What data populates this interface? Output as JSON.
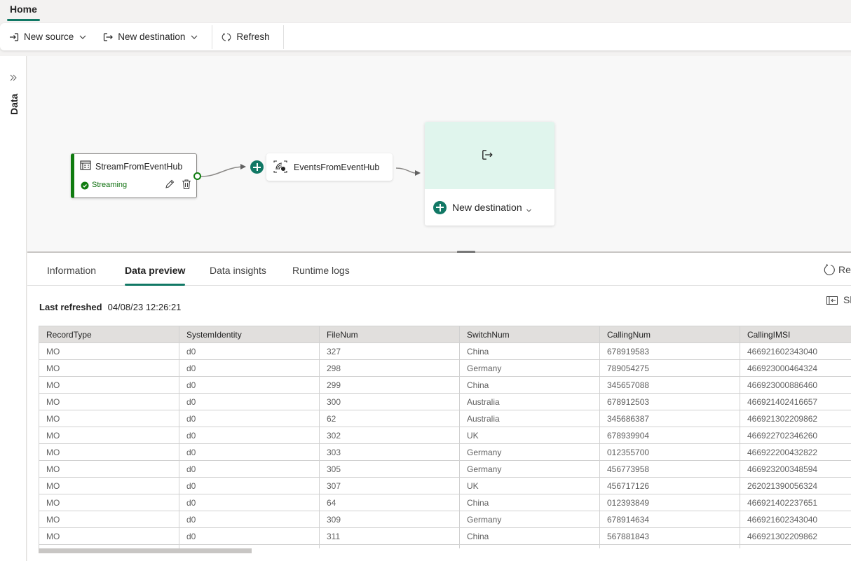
{
  "topbar": {
    "tab": "Home"
  },
  "toolbar": {
    "new_source": "New source",
    "new_destination": "New destination",
    "refresh": "Refresh"
  },
  "rail": {
    "label": "Data"
  },
  "canvas": {
    "source_node": {
      "title": "StreamFromEventHub",
      "status": "Streaming"
    },
    "stream_node": {
      "title": "EventsFromEventHub"
    },
    "destination_card": {
      "label": "New destination"
    }
  },
  "colors": {
    "accent": "#117865",
    "status_green": "#107c10",
    "dest_bg": "#e0f5ed"
  },
  "panel": {
    "tabs": [
      {
        "label": "Information"
      },
      {
        "label": "Data preview",
        "active": true
      },
      {
        "label": "Data insights"
      },
      {
        "label": "Runtime logs"
      }
    ],
    "refresh_label": "Ref",
    "show_label": "Sh",
    "last_refreshed_label": "Last refreshed",
    "last_refreshed_value": "04/08/23 12:26:21"
  },
  "table": {
    "columns": [
      "RecordType",
      "SystemIdentity",
      "FileNum",
      "SwitchNum",
      "CallingNum",
      "CallingIMSI",
      ""
    ],
    "rows": [
      [
        "MO",
        "d0",
        "327",
        "China",
        "678919583",
        "466921602343040",
        ""
      ],
      [
        "MO",
        "d0",
        "298",
        "Germany",
        "789054275",
        "466923000464324",
        ""
      ],
      [
        "MO",
        "d0",
        "299",
        "China",
        "345657088",
        "466923000886460",
        ""
      ],
      [
        "MO",
        "d0",
        "300",
        "Australia",
        "678912503",
        "466921402416657",
        ""
      ],
      [
        "MO",
        "d0",
        "62",
        "Australia",
        "345686387",
        "466921302209862",
        ""
      ],
      [
        "MO",
        "d0",
        "302",
        "UK",
        "678939904",
        "466922702346260",
        ""
      ],
      [
        "MO",
        "d0",
        "303",
        "Germany",
        "012355700",
        "466922200432822",
        ""
      ],
      [
        "MO",
        "d0",
        "305",
        "Germany",
        "456773958",
        "466923200348594",
        ""
      ],
      [
        "MO",
        "d0",
        "307",
        "UK",
        "456717126",
        "262021390056324",
        ""
      ],
      [
        "MO",
        "d0",
        "64",
        "China",
        "012393849",
        "466921402237651",
        ""
      ],
      [
        "MO",
        "d0",
        "309",
        "Germany",
        "678914634",
        "466921602343040",
        ""
      ],
      [
        "MO",
        "d0",
        "311",
        "China",
        "567881843",
        "466921302209862",
        ""
      ],
      [
        "",
        "",
        "",
        "",
        "",
        "",
        ""
      ]
    ]
  }
}
